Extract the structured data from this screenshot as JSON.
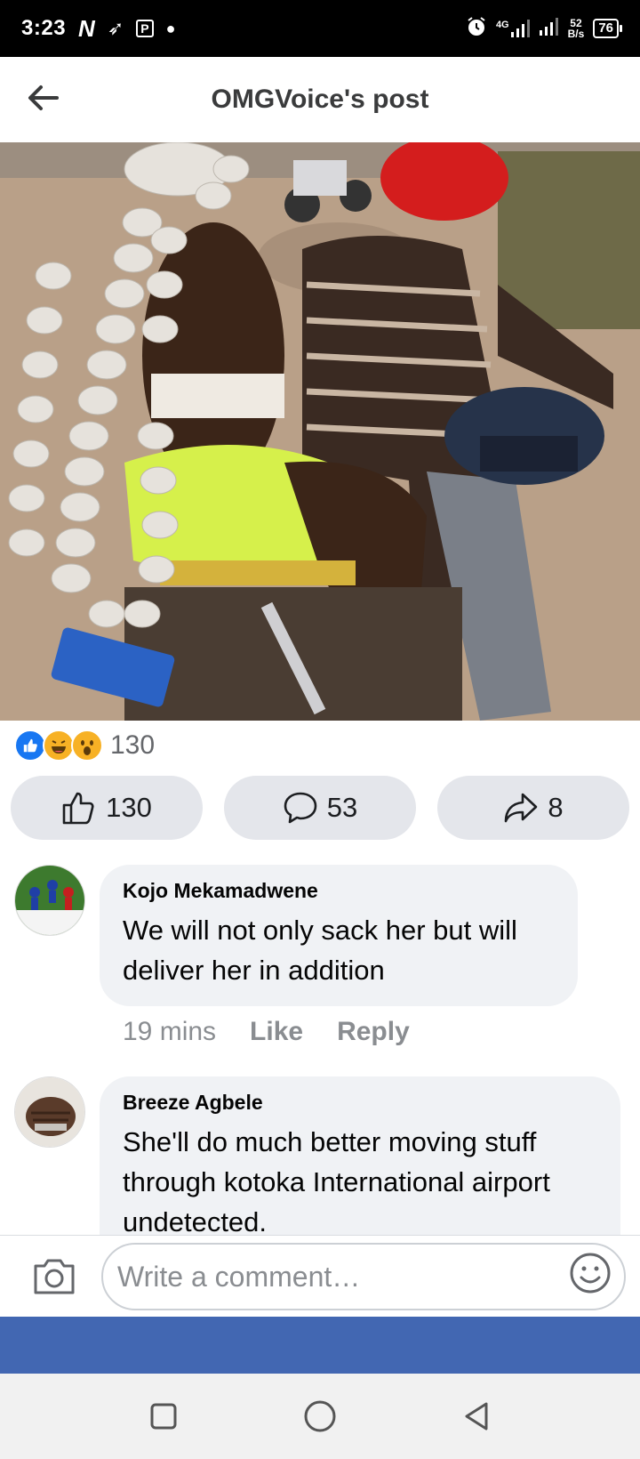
{
  "status_bar": {
    "time": "3:23",
    "network": "4G",
    "speed_value": "52",
    "speed_unit": "B/s",
    "battery": "76"
  },
  "header": {
    "title": "OMGVoice's post"
  },
  "post": {
    "reaction_count": "130",
    "reactions": [
      "like-icon",
      "haha-icon",
      "wow-icon"
    ]
  },
  "actions": {
    "like_count": "130",
    "comment_count": "53",
    "share_count": "8"
  },
  "comments": [
    {
      "author": "Kojo Mekamadwene",
      "text": "We will not only sack her but will deliver her in addition",
      "time": "19 mins",
      "like_label": "Like",
      "reply_label": "Reply"
    },
    {
      "author": "Breeze Agbele",
      "text": "She'll do much better moving stuff through kotoka International airport undetected."
    }
  ],
  "composer": {
    "placeholder": "Write a comment…"
  },
  "colors": {
    "brand_blue": "#4267b2",
    "like_blue": "#1877f2",
    "pill_bg": "#e4e6eb"
  }
}
